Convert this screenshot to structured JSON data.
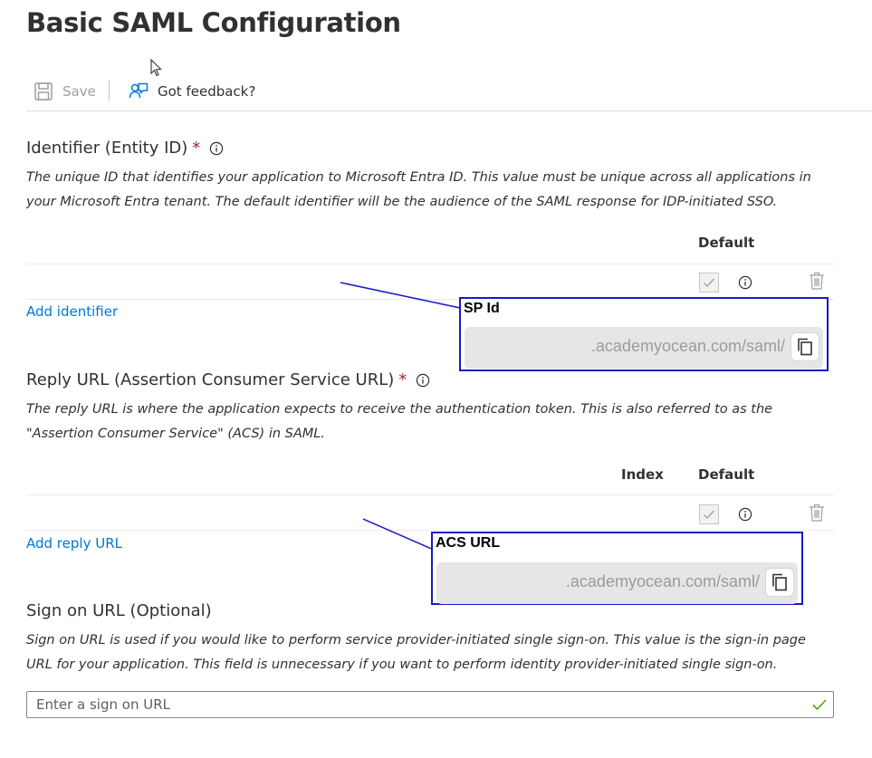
{
  "page": {
    "title": "Basic SAML Configuration"
  },
  "toolbar": {
    "save_label": "Save",
    "feedback_label": "Got feedback?"
  },
  "identifier": {
    "title": "Identifier (Entity ID)",
    "required_mark": "*",
    "description": "The unique ID that identifies your application to Microsoft Entra ID. This value must be unique across all applications in your Microsoft Entra tenant. The default identifier will be the audience of the SAML response for IDP-initiated SSO.",
    "col_default": "Default",
    "add_link": "Add identifier"
  },
  "reply_url": {
    "title": "Reply URL (Assertion Consumer Service URL)",
    "required_mark": "*",
    "description": "The reply URL is where the application expects to receive the authentication token. This is also referred to as the \"Assertion Consumer Service\" (ACS) in SAML.",
    "col_index": "Index",
    "col_default": "Default",
    "add_link": "Add reply URL"
  },
  "sign_on": {
    "title": "Sign on URL (Optional)",
    "description": "Sign on URL is used if you would like to perform service provider-initiated single sign-on. This value is the sign-in page URL for your application. This field is unnecessary if you want to perform identity provider-initiated single sign-on.",
    "placeholder": "Enter a sign on URL"
  },
  "callouts": {
    "sp_id": {
      "label": "SP Id",
      "value": ".academyocean.com/saml/"
    },
    "acs_url": {
      "label": "ACS URL",
      "value": ".academyocean.com/saml/"
    }
  },
  "colors": {
    "link": "#0078d4",
    "required": "#a4262c",
    "callout_border": "#1a1ac8",
    "valid_check": "#57a300"
  },
  "icons": [
    "save-icon",
    "feedback-icon",
    "info-icon",
    "checkbox-icon",
    "delete-icon",
    "copy-icon",
    "checkmark-icon",
    "cursor-icon"
  ]
}
